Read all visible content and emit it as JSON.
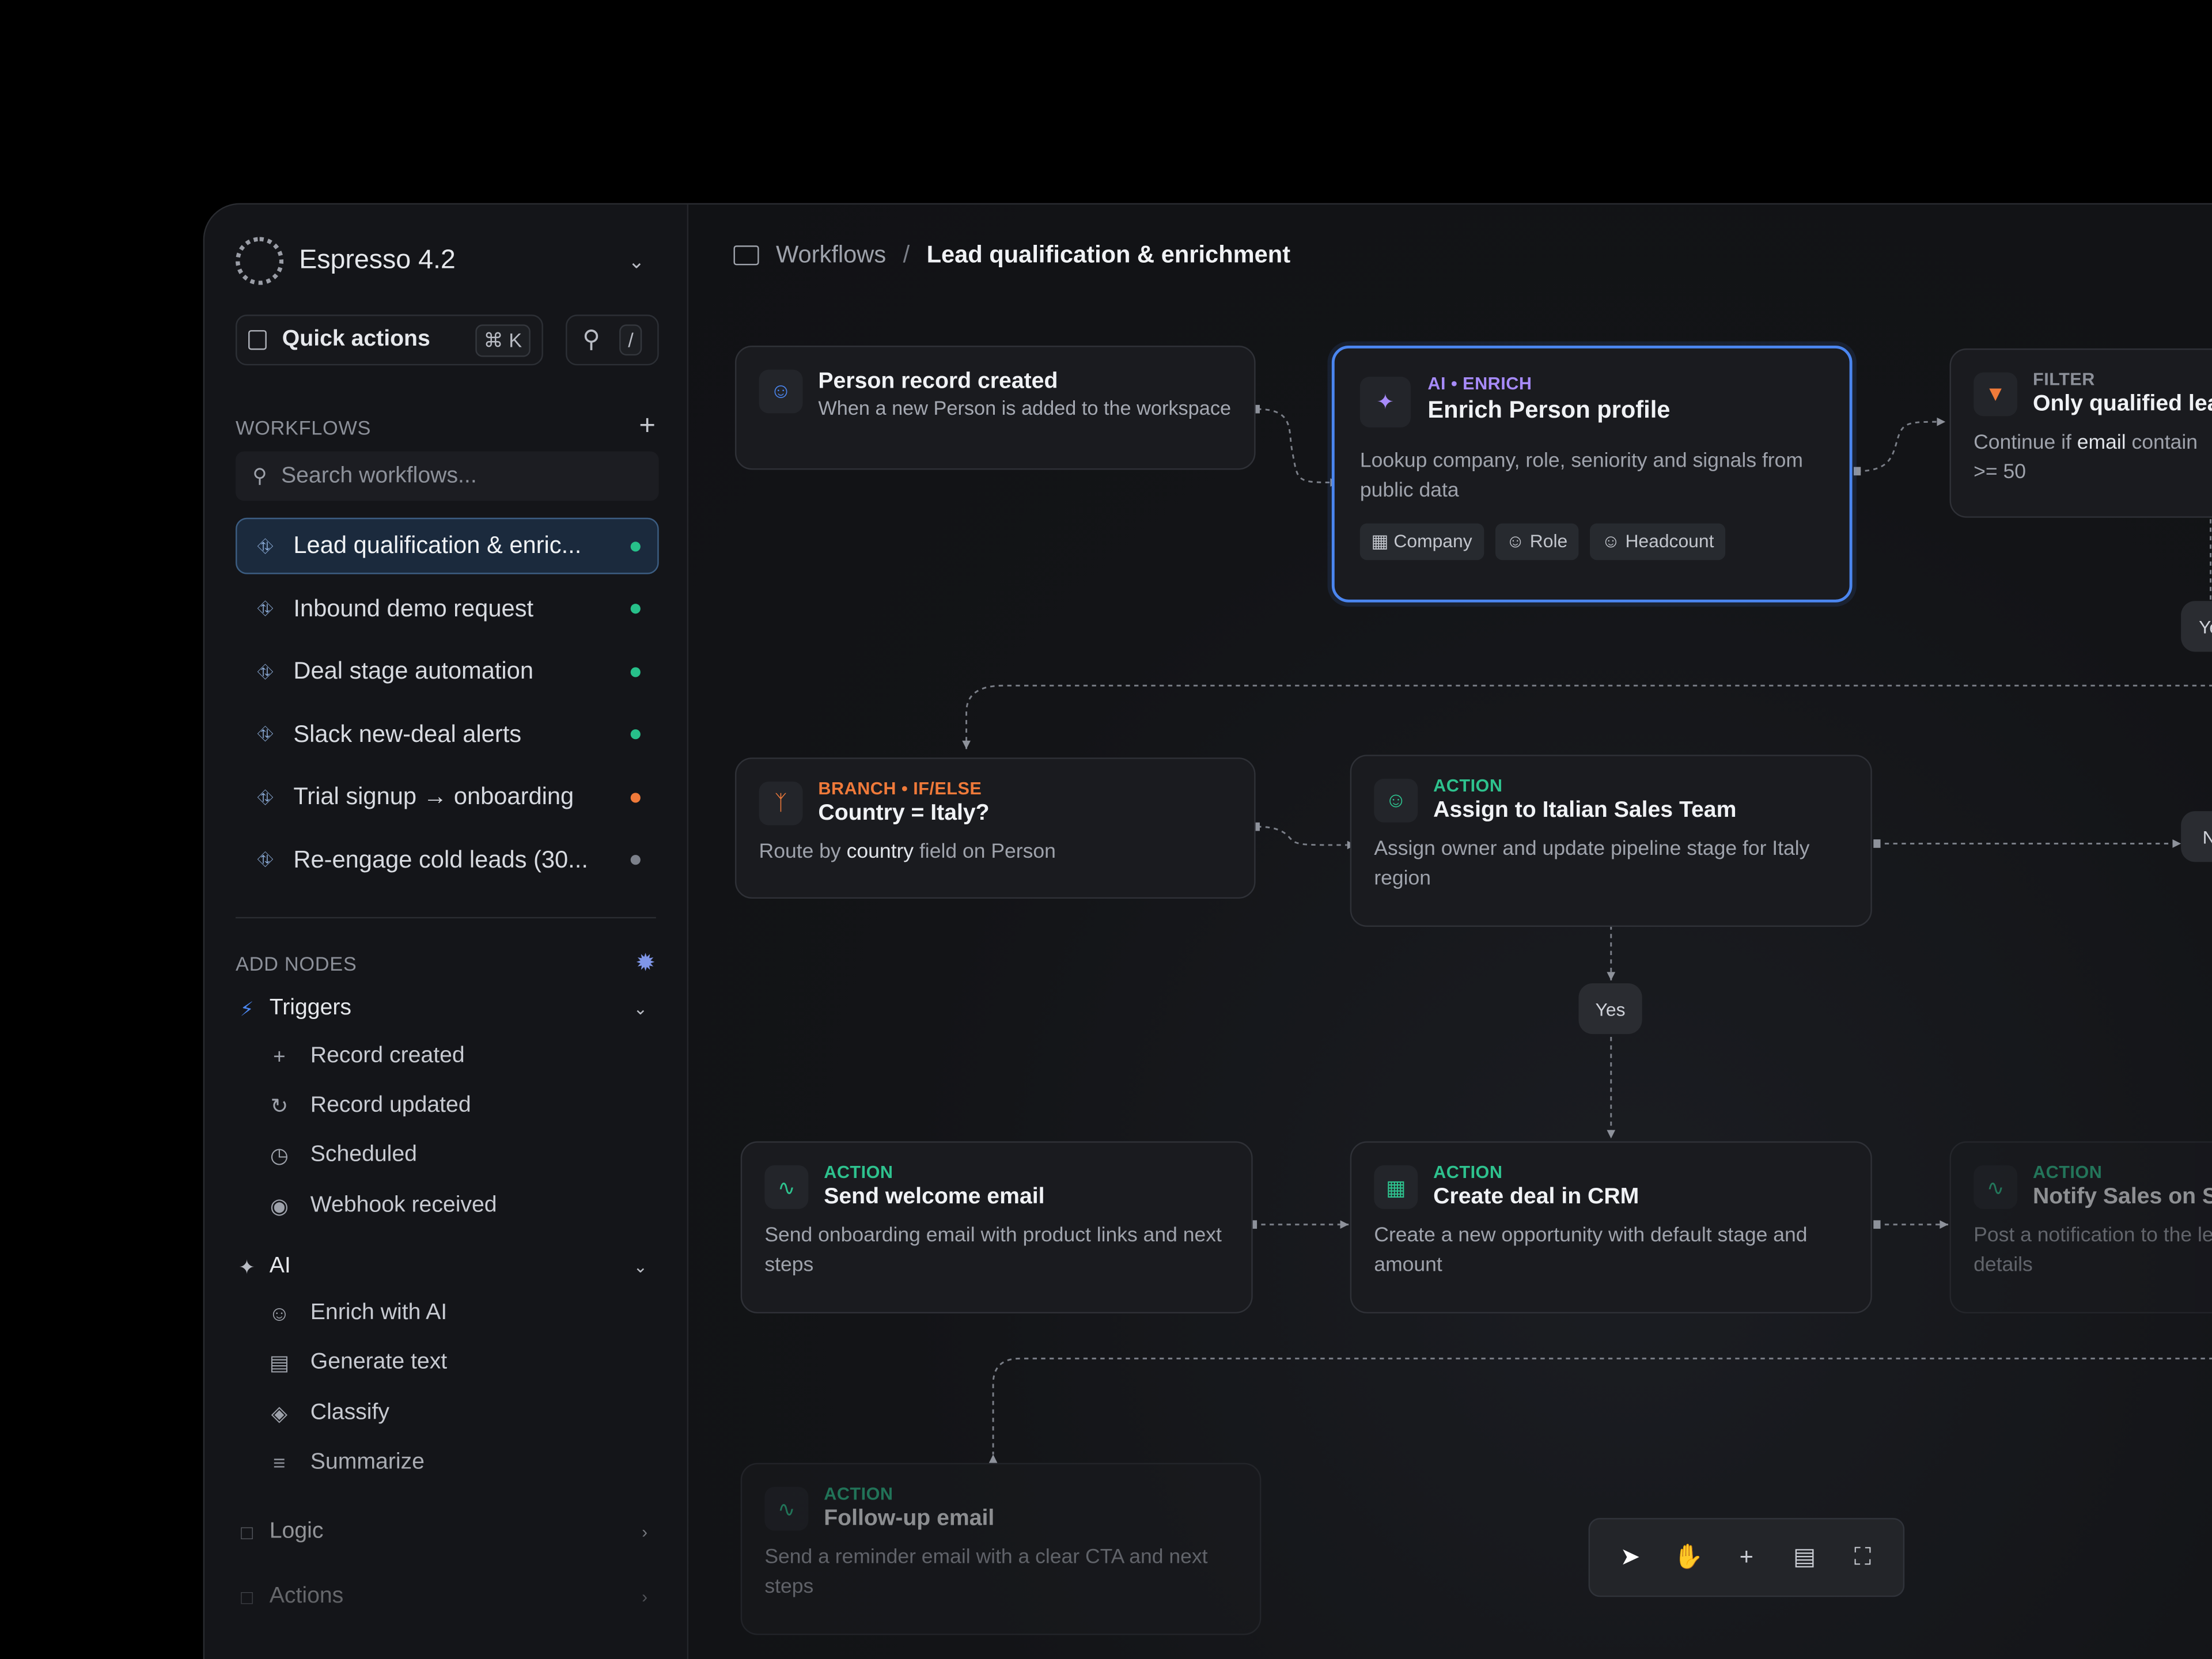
{
  "workspace": {
    "name": "Espresso 4.2"
  },
  "quick_actions": {
    "label": "Quick actions",
    "shortcut": "⌘ K",
    "search_shortcut": "/"
  },
  "workflows_section": {
    "title": "WORKFLOWS",
    "search_placeholder": "Search workflows...",
    "items": [
      {
        "label": "Lead qualification & enric...",
        "status": "#27c08a",
        "active": true
      },
      {
        "label": "Inbound demo request",
        "status": "#27c08a"
      },
      {
        "label": "Deal stage automation",
        "status": "#27c08a"
      },
      {
        "label": "Slack new-deal alerts",
        "status": "#27c08a"
      },
      {
        "label": "Trial signup → onboarding",
        "status": "#f07a3a"
      },
      {
        "label": "Re-engage cold leads (30...",
        "status": "#7c808a"
      }
    ]
  },
  "add_nodes": {
    "title": "ADD NODES",
    "groups": [
      {
        "label": "Triggers",
        "icon": "bolt-icon",
        "items": [
          "Record created",
          "Record updated",
          "Scheduled",
          "Webhook received"
        ]
      },
      {
        "label": "AI",
        "icon": "sparkles-icon",
        "items": [
          "Enrich with AI",
          "Generate text",
          "Classify",
          "Summarize"
        ]
      },
      {
        "label": "Logic",
        "icon": "folder-icon",
        "items": []
      },
      {
        "label": "Actions",
        "icon": "folder-icon",
        "items": []
      }
    ]
  },
  "breadcrumb": {
    "root": "Workflows",
    "separator": "/",
    "current": "Lead qualification & enrichment"
  },
  "nodes": {
    "trigger": {
      "title": "Person record created",
      "desc": "When a new Person is added to the workspace"
    },
    "enrich": {
      "tag": "AI • ENRICH",
      "title": "Enrich Person profile",
      "desc": "Lookup company, role, seniority and signals from public data",
      "chips": [
        "Company",
        "Role",
        "Headcount"
      ]
    },
    "filter": {
      "tag": "FILTER",
      "title": "Only qualified lea",
      "desc_pre": "Continue if",
      "desc_field": "email",
      "desc_post": "contain",
      "desc_line2": ">= 50"
    },
    "branch": {
      "tag": "BRANCH • IF/ELSE",
      "title": "Country = Italy?",
      "desc_pre": "Route by",
      "desc_field": "country",
      "desc_post": "field on Person"
    },
    "assign": {
      "tag": "ACTION",
      "title": "Assign to Italian Sales Team",
      "desc": "Assign owner and update pipeline stage for Italy region"
    },
    "welcome": {
      "tag": "ACTION",
      "title": "Send welcome email",
      "desc": "Send onboarding email with product links and next steps"
    },
    "crm": {
      "tag": "ACTION",
      "title": "Create deal in CRM",
      "desc": "Create a new opportunity with default stage and amount"
    },
    "notify": {
      "tag": "ACTION",
      "title": "Notify Sales on S",
      "desc": "Post a notification to the lead details"
    },
    "followup": {
      "tag": "ACTION",
      "title": "Follow-up email",
      "desc": "Send a reminder email with a clear CTA and next steps"
    }
  },
  "edge_labels": {
    "yes": "Yes",
    "ye_partial": "Ye",
    "n_partial": "N"
  },
  "colors": {
    "accent_blue": "#4b86f0",
    "ai_purple": "#a78bfa",
    "action_green": "#2ec28e",
    "branch_orange": "#f07a3a",
    "filter_gray": "#8c9099"
  }
}
